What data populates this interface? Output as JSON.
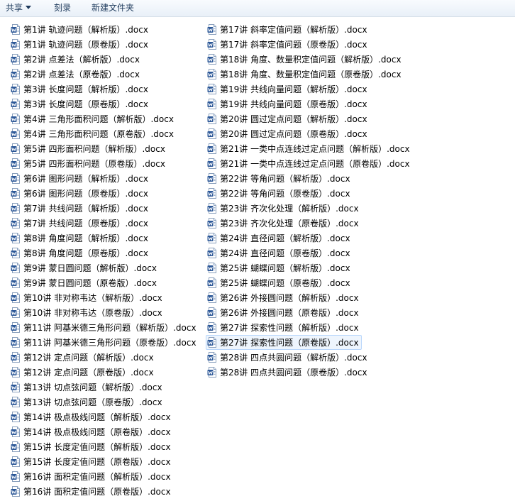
{
  "toolbar": {
    "share_label": "共享",
    "burn_label": "刻录",
    "new_folder_label": "新建文件夹"
  },
  "files": {
    "column_1": [
      "第1讲 轨迹问题（解析版）.docx",
      "第1讲 轨迹问题（原卷版）.docx",
      "第2讲 点差法（解析版）.docx",
      "第2讲 点差法（原卷版）.docx",
      "第3讲 长度问题（解析版）.docx",
      "第3讲 长度问题（原卷版）.docx",
      "第4讲 三角形面积问题（解析版）.docx",
      "第4讲 三角形面积问题（原卷版）.docx",
      "第5讲 四形面积问题（解析版）.docx",
      "第5讲 四形面积问题（原卷版）.docx",
      "第6讲 图形问题（解析版）.docx",
      "第6讲 图形问题（原卷版）.docx",
      "第7讲 共线问题（解析版）.docx",
      "第7讲 共线问题（原卷版）.docx",
      "第8讲 角度问题（解析版）.docx",
      "第8讲 角度问题（原卷版）.docx",
      "第9讲 蒙日圆问题（解析版）.docx",
      "第9讲 蒙日圆问题（原卷版）.docx",
      "第10讲 非对称韦达（解析版）.docx",
      "第10讲 非对称韦达（原卷版）.docx",
      "第11讲 阿基米德三角形问题（解析版）.docx",
      "第11讲 阿基米德三角形问题（原卷版）.docx",
      "第12讲 定点问题（解析版）.docx",
      "第12讲 定点问题（原卷版）.docx",
      "第13讲 切点弦问题（解析版）.docx",
      "第13讲 切点弦问题（原卷版）.docx",
      "第14讲 极点极线问题（解析版）.docx",
      "第14讲 极点极线问题（原卷版）.docx",
      "第15讲 长度定值问题（解析版）.docx",
      "第15讲 长度定值问题（原卷版）.docx",
      "第16讲 面积定值问题（解析版）.docx",
      "第16讲 面积定值问题（原卷版）.docx"
    ],
    "column_2": [
      "第17讲 斜率定值问题（解析版）.docx",
      "第17讲 斜率定值问题（原卷版）.docx",
      "第18讲 角度、数量积定值问题（解析版）.docx",
      "第18讲 角度、数量积定值问题（原卷版）.docx",
      "第19讲 共线向量问题（解析版）.docx",
      "第19讲 共线向量问题（原卷版）.docx",
      "第20讲 圆过定点问题（解析版）.docx",
      "第20讲 圆过定点问题（原卷版）.docx",
      "第21讲 一类中点连线过定点问题（解析版）.docx",
      "第21讲 一类中点连线过定点问题（原卷版）.docx",
      "第22讲 等角问题（解析版）.docx",
      "第22讲 等角问题（原卷版）.docx",
      "第23讲 齐次化处理（解析版）.docx",
      "第23讲 齐次化处理（原卷版）.docx",
      "第24讲 直径问题（解析版）.docx",
      "第24讲 直径问题（原卷版）.docx",
      "第25讲 蝴蝶问题（解析版）.docx",
      "第25讲 蝴蝶问题（原卷版）.docx",
      "第26讲 外接圆问题（解析版）.docx",
      "第26讲 外接圆问题（原卷版）.docx",
      "第27讲 探索性问题（解析版）.docx",
      "第27讲 探索性问题（原卷版）.docx",
      "第28讲 四点共圆问题（解析版）.docx",
      "第28讲 四点共圆问题（原卷版）.docx"
    ],
    "hovered_item": "第27讲 探索性问题（原卷版）.docx",
    "file_icon": "word-document-icon"
  },
  "colors": {
    "icon_blue": "#2b5797",
    "hover_fill": "#eef5fd",
    "hover_border": "#b8d6fb",
    "toolbar_text": "#1e3a5c"
  }
}
